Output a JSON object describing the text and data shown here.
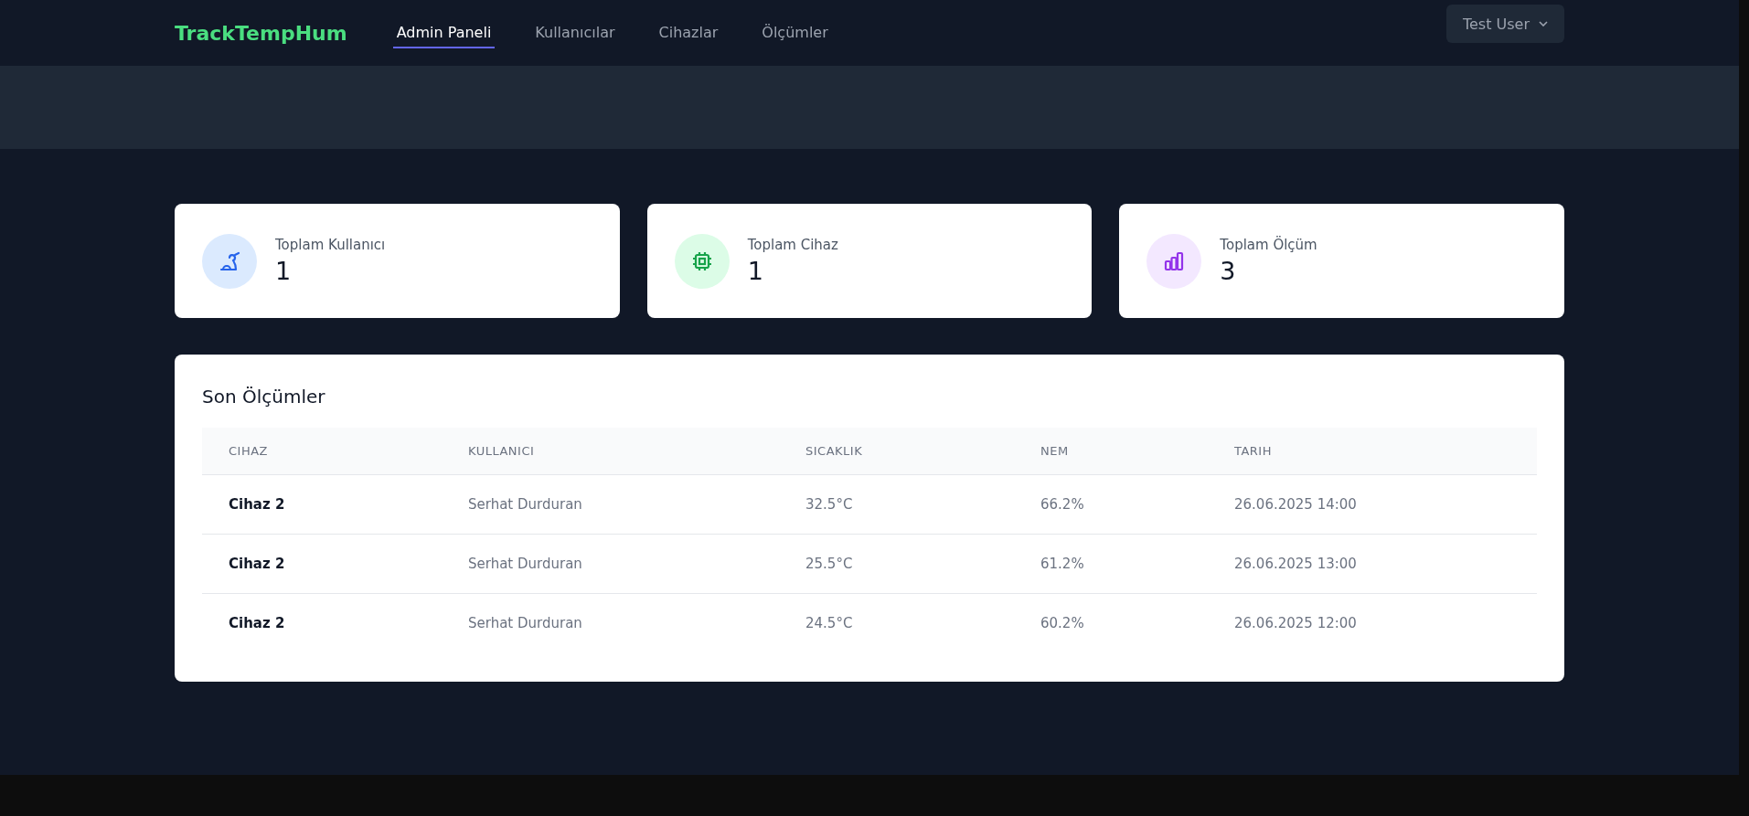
{
  "navbar": {
    "brand": "TrackTempHum",
    "tabs": [
      {
        "label": "Admin Paneli",
        "selected": true
      },
      {
        "label": "Kullanıcılar",
        "selected": false
      },
      {
        "label": "Cihazlar",
        "selected": false
      },
      {
        "label": "Ölçümler",
        "selected": false
      }
    ],
    "user_menu": {
      "label": "Test User"
    }
  },
  "stats": [
    {
      "kind": "users",
      "label": "Toplam Kullanıcı",
      "value": "1"
    },
    {
      "kind": "devices",
      "label": "Toplam Cihaz",
      "value": "1"
    },
    {
      "kind": "measurements",
      "label": "Toplam Ölçüm",
      "value": "3"
    }
  ],
  "recent": {
    "title": "Son Ölçümler",
    "columns": [
      "CIHAZ",
      "KULLANICI",
      "SICAKLIK",
      "NEM",
      "TARIH"
    ],
    "rows": [
      [
        "Cihaz 2",
        "Serhat Durduran",
        "32.5°C",
        "66.2%",
        "26.06.2025 14:00"
      ],
      [
        "Cihaz 2",
        "Serhat Durduran",
        "25.5°C",
        "61.2%",
        "26.06.2025 13:00"
      ],
      [
        "Cihaz 2",
        "Serhat Durduran",
        "24.5°C",
        "60.2%",
        "26.06.2025 12:00"
      ]
    ]
  }
}
